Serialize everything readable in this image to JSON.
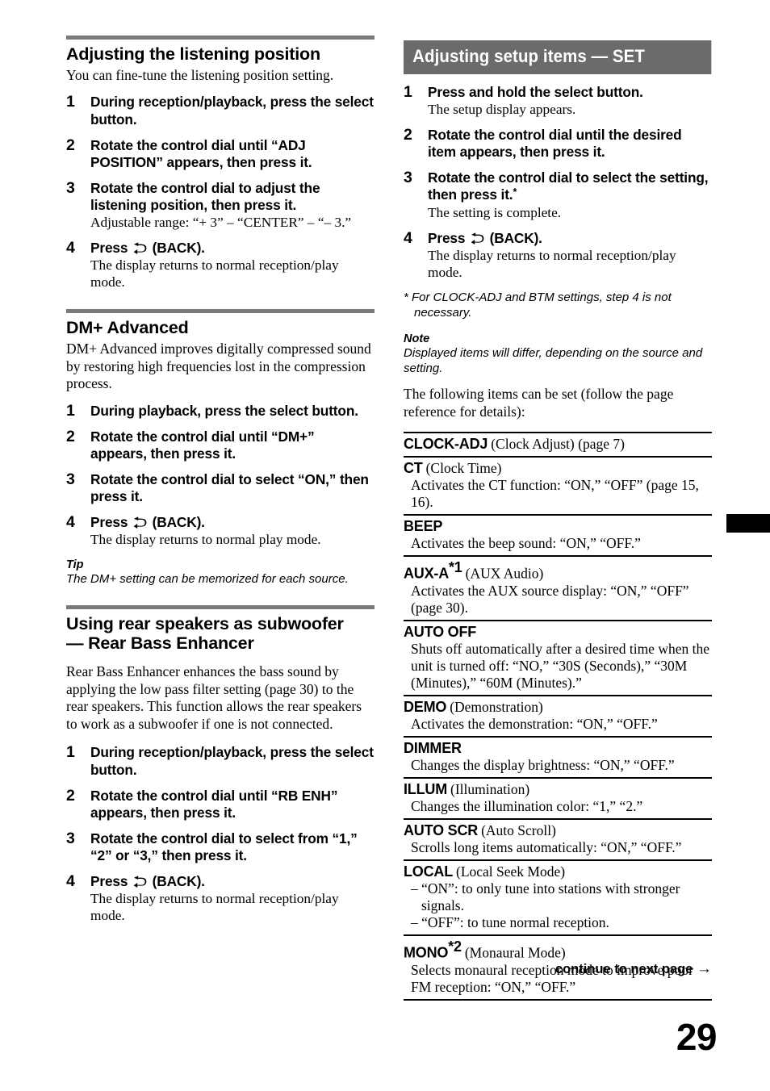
{
  "page_number": "29",
  "colors": {
    "heading_rule": "#7a7a7a",
    "bar_heading_bg": "#6b6b6b",
    "bar_heading_text": "#ffffff",
    "table_rule": "#000000",
    "edge_tab": "#000000"
  },
  "footer": {
    "continue_text": "continue to next page",
    "continue_arrow": "→"
  },
  "icons": {
    "back_arrow": "back-arrow-icon"
  },
  "left_column": {
    "sections": [
      {
        "title": "Adjusting the listening position",
        "lead": "You can fine-tune the listening position setting.",
        "steps": [
          {
            "num": "1",
            "head": "During reception/playback, press the select button.",
            "sub": ""
          },
          {
            "num": "2",
            "head": "Rotate the control dial until “ADJ POSITION” appears, then press it.",
            "sub": ""
          },
          {
            "num": "3",
            "head": "Rotate the control dial to adjust the listening position, then press it.",
            "sub": "Adjustable range: “+ 3” – “CENTER” – “– 3.”"
          },
          {
            "num": "4",
            "head_before_icon": "Press",
            "head_after_icon": "(BACK).",
            "sub": "The display returns to normal reception/play mode."
          }
        ]
      },
      {
        "title": "DM+ Advanced",
        "lead": "DM+ Advanced improves digitally compressed sound by restoring high frequencies lost in the compression process.",
        "steps": [
          {
            "num": "1",
            "head": "During playback, press the select button.",
            "sub": ""
          },
          {
            "num": "2",
            "head": "Rotate the control dial until “DM+” appears, then press it.",
            "sub": ""
          },
          {
            "num": "3",
            "head": "Rotate the control dial to select “ON,” then press it.",
            "sub": ""
          },
          {
            "num": "4",
            "head_before_icon": "Press",
            "head_after_icon": "(BACK).",
            "sub": "The display returns to normal play mode."
          }
        ],
        "tip_label": "Tip",
        "tip_body": "The DM+ setting can be memorized for each source."
      },
      {
        "title_line1": "Using rear speakers as subwoofer",
        "title_line2": "— Rear Bass Enhancer",
        "lead": "Rear Bass Enhancer enhances the bass sound by applying the low pass filter setting (page 30) to the rear speakers. This function allows the rear speakers to work as a subwoofer if one is not connected.",
        "steps": [
          {
            "num": "1",
            "head": "During reception/playback, press the select button.",
            "sub": ""
          },
          {
            "num": "2",
            "head": "Rotate the control dial until “RB ENH” appears, then press it.",
            "sub": ""
          },
          {
            "num": "3",
            "head": "Rotate the control dial to select from “1,” “2” or “3,” then press it.",
            "sub": ""
          },
          {
            "num": "4",
            "head_before_icon": "Press",
            "head_after_icon": "(BACK).",
            "sub": "The display returns to normal reception/play mode."
          }
        ]
      }
    ]
  },
  "right_column": {
    "bar_title": "Adjusting setup items — SET",
    "steps": [
      {
        "num": "1",
        "head": "Press and hold the select button.",
        "sub": "The setup display appears."
      },
      {
        "num": "2",
        "head": "Rotate the control dial until the desired item appears, then press it.",
        "sub": ""
      },
      {
        "num": "3",
        "head": "Rotate the control dial to select the setting, then press it.",
        "head_sup": "*",
        "sub": "The setting is complete."
      },
      {
        "num": "4",
        "head_before_icon": "Press",
        "head_after_icon": "(BACK).",
        "sub": "The display returns to normal reception/play mode."
      }
    ],
    "footnote": "* For CLOCK-ADJ and BTM settings, step 4 is not necessary.",
    "note_label": "Note",
    "note_body": "Displayed items will differ, depending on the source and setting.",
    "intro": "The following items can be set (follow the page reference for details):",
    "settings": [
      {
        "term": "CLOCK-ADJ",
        "term_paren": "(Clock Adjust) (page 7)",
        "desc": []
      },
      {
        "term": "CT",
        "term_paren": "(Clock Time)",
        "desc": [
          "Activates the CT function: “ON,” “OFF” (page 15, 16)."
        ]
      },
      {
        "term": "BEEP",
        "term_paren": "",
        "desc": [
          "Activates the beep sound: “ON,” “OFF.”"
        ]
      },
      {
        "term": "AUX-A",
        "term_sup": "*1",
        "term_paren": "(AUX Audio)",
        "desc": [
          "Activates the AUX source display: “ON,” “OFF” (page 30)."
        ]
      },
      {
        "term": "AUTO OFF",
        "term_paren": "",
        "desc": [
          "Shuts off automatically after a desired time when the unit is turned off: “NO,” “30S (Seconds),” “30M (Minutes),” “60M (Minutes).”"
        ]
      },
      {
        "term": "DEMO",
        "term_paren": "(Demonstration)",
        "desc": [
          "Activates the demonstration: “ON,” “OFF.”"
        ]
      },
      {
        "term": "DIMMER",
        "term_paren": "",
        "desc": [
          "Changes the display brightness: “ON,” “OFF.”"
        ]
      },
      {
        "term": "ILLUM",
        "term_paren": "(Illumination)",
        "desc": [
          "Changes the illumination color: “1,” “2.”"
        ]
      },
      {
        "term": "AUTO SCR",
        "term_paren": "(Auto Scroll)",
        "desc": [
          "Scrolls long items automatically: “ON,” “OFF.”"
        ]
      },
      {
        "term": "LOCAL",
        "term_paren": "(Local Seek Mode)",
        "desc_dashed": [
          "– “ON”: to only tune into stations with stronger signals.",
          "– “OFF”: to tune normal reception."
        ]
      },
      {
        "term": "MONO",
        "term_sup": "*2",
        "term_paren": "(Monaural Mode)",
        "desc": [
          "Selects monaural reception mode to improve poor FM reception: “ON,” “OFF.”"
        ]
      }
    ]
  }
}
